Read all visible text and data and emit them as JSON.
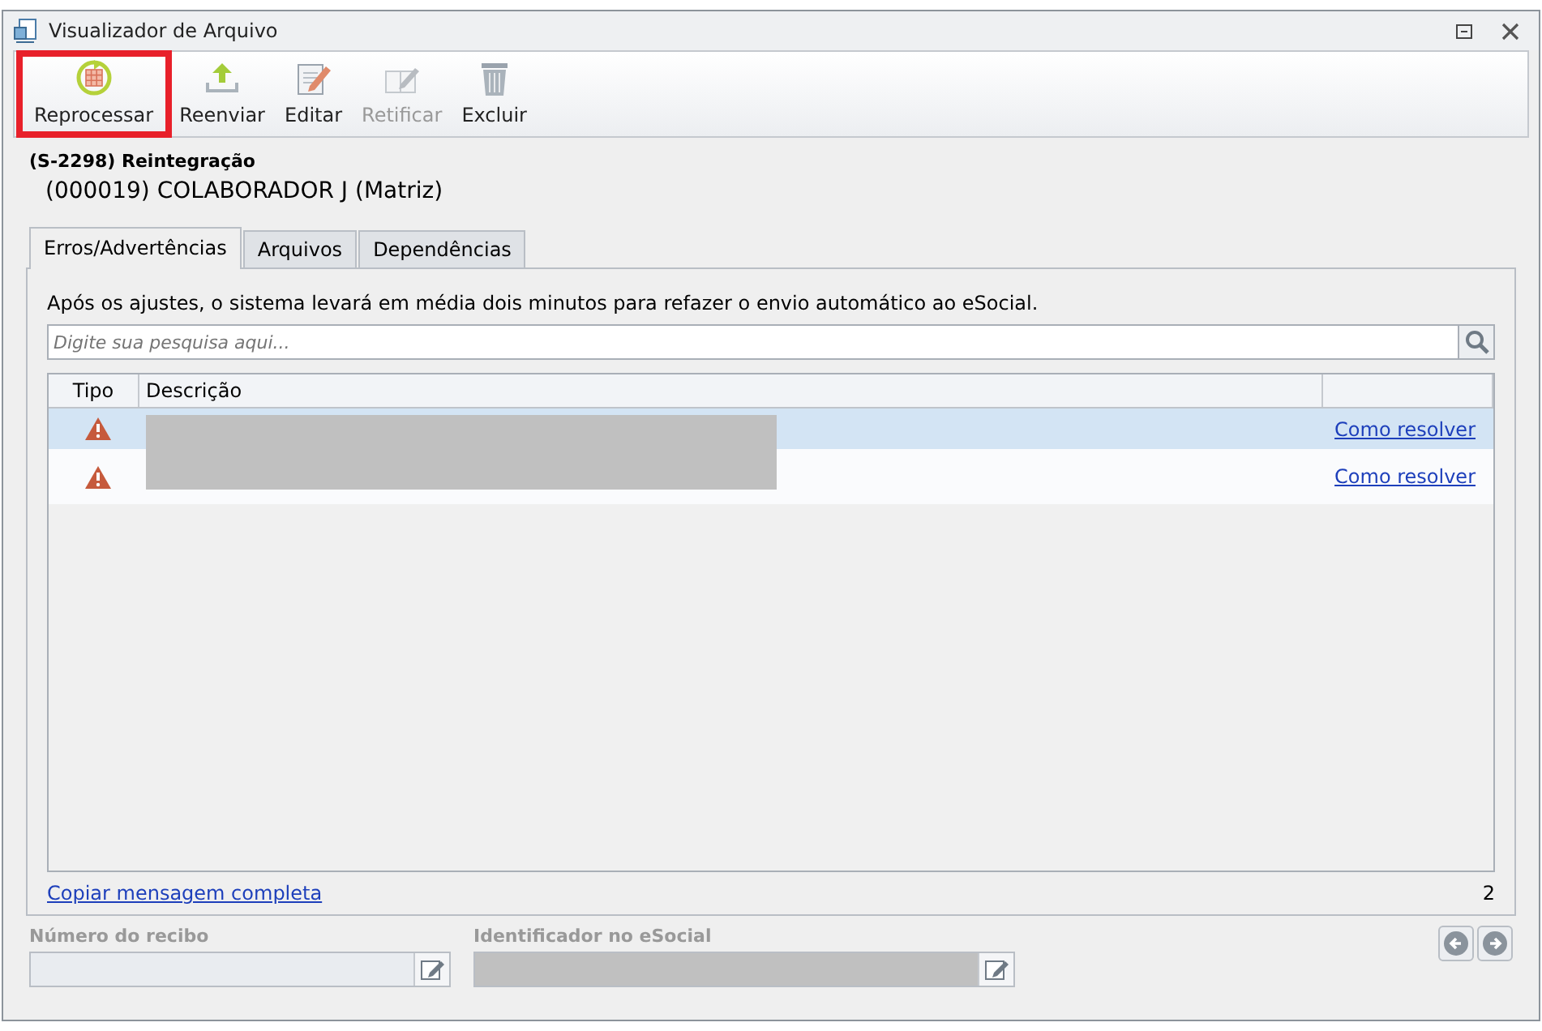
{
  "window": {
    "title": "Visualizador de Arquivo"
  },
  "toolbar": [
    {
      "kind": "reprocess",
      "label": "Reprocessar",
      "disabled": false,
      "highlighted": true
    },
    {
      "kind": "upload",
      "label": "Reenviar",
      "disabled": false,
      "highlighted": false
    },
    {
      "kind": "edit",
      "label": "Editar",
      "disabled": false,
      "highlighted": false
    },
    {
      "kind": "rectify",
      "label": "Retificar",
      "disabled": true,
      "highlighted": false
    },
    {
      "kind": "delete",
      "label": "Excluir",
      "disabled": false,
      "highlighted": false
    }
  ],
  "header": {
    "event": "(S-2298) Reintegração",
    "employee": "(000019) COLABORADOR J (Matriz)"
  },
  "tabs": [
    {
      "label": "Erros/Advertências",
      "selected": true
    },
    {
      "label": "Arquivos",
      "selected": false
    },
    {
      "label": "Dependências",
      "selected": false
    }
  ],
  "info": "Após os ajustes, o sistema levará em média dois minutos para refazer o envio automático ao eSocial.",
  "search": {
    "placeholder": "Digite sua pesquisa aqui..."
  },
  "table": {
    "columns": [
      "Tipo",
      "Descrição"
    ],
    "rows": [
      {
        "kind": "warning",
        "link": "Como resolver",
        "selected": true
      },
      {
        "kind": "warning",
        "link": "Como resolver",
        "selected": false
      }
    ]
  },
  "footer": {
    "link": "Copiar mensagem completa",
    "count": "2"
  },
  "fields": [
    {
      "label": "Número do recibo",
      "redacted": false
    },
    {
      "label": "Identificador no eSocial",
      "redacted": true
    }
  ]
}
